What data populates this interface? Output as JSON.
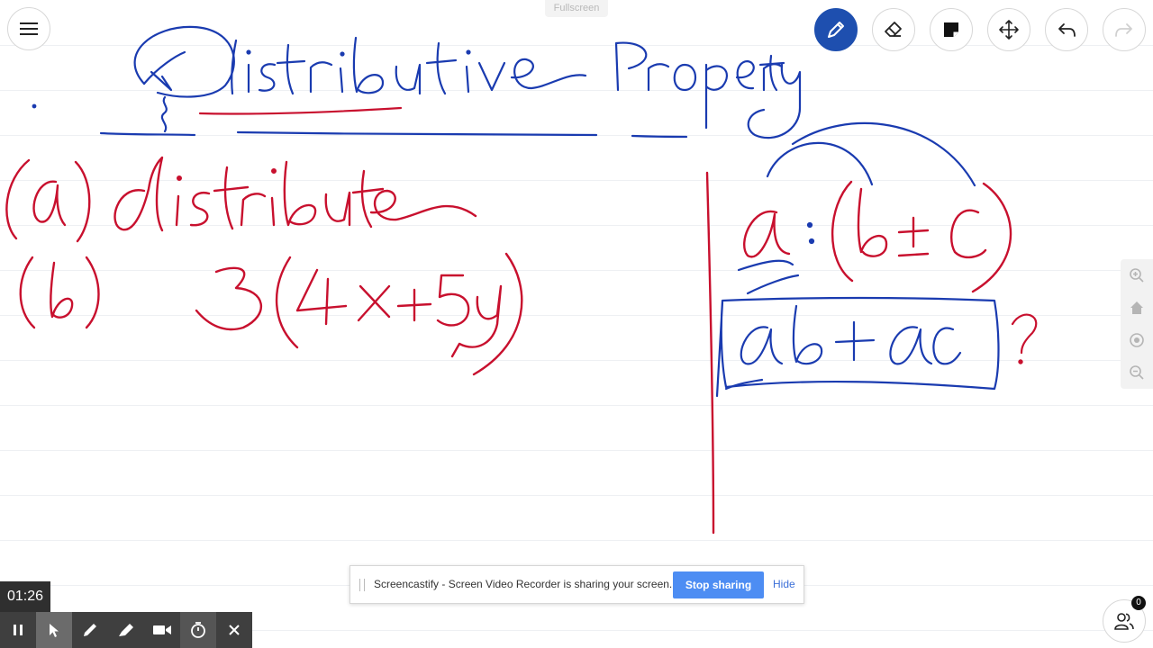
{
  "topbar": {
    "fullscreen_label": "Fullscreen",
    "tools": [
      {
        "name": "pen",
        "icon": "pencil-icon",
        "active": true
      },
      {
        "name": "eraser",
        "icon": "eraser-icon",
        "active": false
      },
      {
        "name": "sticky-note",
        "icon": "sticky-note-icon",
        "active": false
      },
      {
        "name": "move",
        "icon": "move-icon",
        "active": false
      },
      {
        "name": "undo",
        "icon": "undo-icon",
        "active": false
      },
      {
        "name": "redo",
        "icon": "redo-icon",
        "active": false,
        "disabled": true
      }
    ]
  },
  "zoom_panel": {
    "items": [
      "zoom-in-icon",
      "home-icon",
      "target-icon",
      "zoom-out-icon"
    ]
  },
  "share_bar": {
    "message": "Screencastify - Screen Video Recorder is sharing your screen.",
    "stop_label": "Stop sharing",
    "hide_label": "Hide"
  },
  "recorder": {
    "elapsed": "01:26",
    "controls": [
      "pause-icon",
      "cursor-icon",
      "pen-icon",
      "highlighter-icon",
      "camera-icon",
      "timer-icon",
      "close-icon"
    ]
  },
  "collaborators": {
    "count": "0"
  },
  "colors": {
    "accent": "#1e4faf",
    "ink_blue": "#1a3bb0",
    "ink_red": "#c8102e",
    "stop_button": "#4d8df3"
  }
}
